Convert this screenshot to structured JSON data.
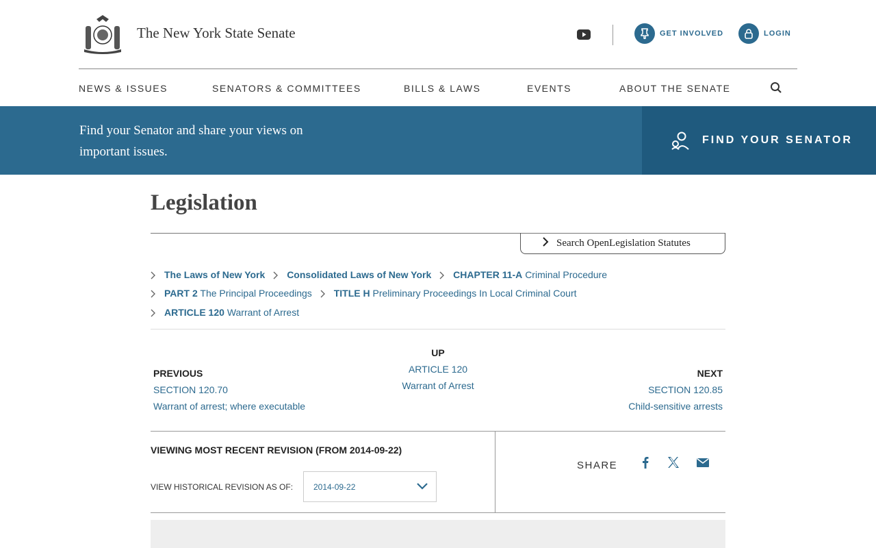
{
  "header": {
    "site_name": "The New York State Senate",
    "get_involved": "GET INVOLVED",
    "login": "LOGIN"
  },
  "nav": {
    "items": [
      "NEWS & ISSUES",
      "SENATORS & COMMITTEES",
      "BILLS & LAWS",
      "EVENTS",
      "ABOUT THE SENATE"
    ]
  },
  "banner": {
    "text": "Find your Senator and share your views on important issues.",
    "cta": "FIND YOUR SENATOR"
  },
  "main": {
    "title": "Legislation",
    "search_link": "Search OpenLegislation Statutes",
    "breadcrumbs": [
      {
        "strong": "The Laws of New York",
        "rest": ""
      },
      {
        "strong": "Consolidated Laws of New York",
        "rest": ""
      },
      {
        "strong": "CHAPTER 11-A",
        "rest": "Criminal Procedure"
      },
      {
        "strong": "PART 2",
        "rest": "The Principal Proceedings"
      },
      {
        "strong": "TITLE H",
        "rest": "Preliminary Proceedings In Local Criminal Court"
      },
      {
        "strong": "ARTICLE 120",
        "rest": "Warrant of Arrest"
      }
    ],
    "prev": {
      "heading": "PREVIOUS",
      "line1": "SECTION 120.70",
      "line2": "Warrant of arrest; where executable"
    },
    "up": {
      "heading": "UP",
      "line1": "ARTICLE 120",
      "line2": "Warrant of Arrest"
    },
    "next": {
      "heading": "NEXT",
      "line1": "SECTION 120.85",
      "line2": "Child-sensitive arrests"
    },
    "revision": {
      "title": "VIEWING MOST RECENT REVISION (FROM 2014-09-22)",
      "label": "VIEW HISTORICAL REVISION AS OF:",
      "selected": "2014-09-22"
    },
    "share": {
      "label": "SHARE"
    }
  },
  "colors": {
    "accent": "#2c6a8f",
    "banner_dark": "#1f5a7e"
  }
}
